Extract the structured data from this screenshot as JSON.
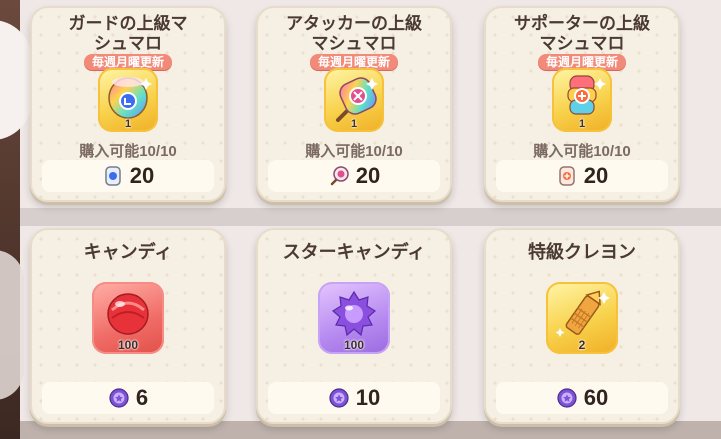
{
  "shop": {
    "items": [
      {
        "title_line1": "ガードの上級マ",
        "title_line2": "シュマロ",
        "badge": "毎週月曜更新",
        "qty": "1",
        "limit": "購入可能10/10",
        "price": "20",
        "currency_icon": "guard-marshmallow-ticket-icon",
        "item_icon": "guard-marshmallow-icon"
      },
      {
        "title_line1": "アタッカーの上級",
        "title_line2": "マシュマロ",
        "badge": "毎週月曜更新",
        "qty": "1",
        "limit": "購入可能10/10",
        "price": "20",
        "currency_icon": "attacker-marshmallow-ticket-icon",
        "item_icon": "attacker-marshmallow-icon"
      },
      {
        "title_line1": "サポーターの上級",
        "title_line2": "マシュマロ",
        "badge": "毎週月曜更新",
        "qty": "1",
        "limit": "購入可能10/10",
        "price": "20",
        "currency_icon": "supporter-marshmallow-ticket-icon",
        "item_icon": "supporter-marshmallow-icon"
      },
      {
        "title": "キャンディ",
        "qty": "100",
        "price": "6",
        "currency_icon": "purple-medal-icon",
        "item_icon": "red-candy-icon"
      },
      {
        "title": "スターキャンディ",
        "qty": "100",
        "price": "10",
        "currency_icon": "purple-medal-icon",
        "item_icon": "star-candy-icon"
      },
      {
        "title": "特級クレヨン",
        "qty": "2",
        "price": "60",
        "currency_icon": "purple-medal-icon",
        "item_icon": "crayon-icon"
      }
    ]
  },
  "colors": {
    "badge": "#f28a7a",
    "card_bg": "#f6efe3",
    "gold": "#f8d24c",
    "red": "#f06c66",
    "purple": "#b68af0"
  }
}
